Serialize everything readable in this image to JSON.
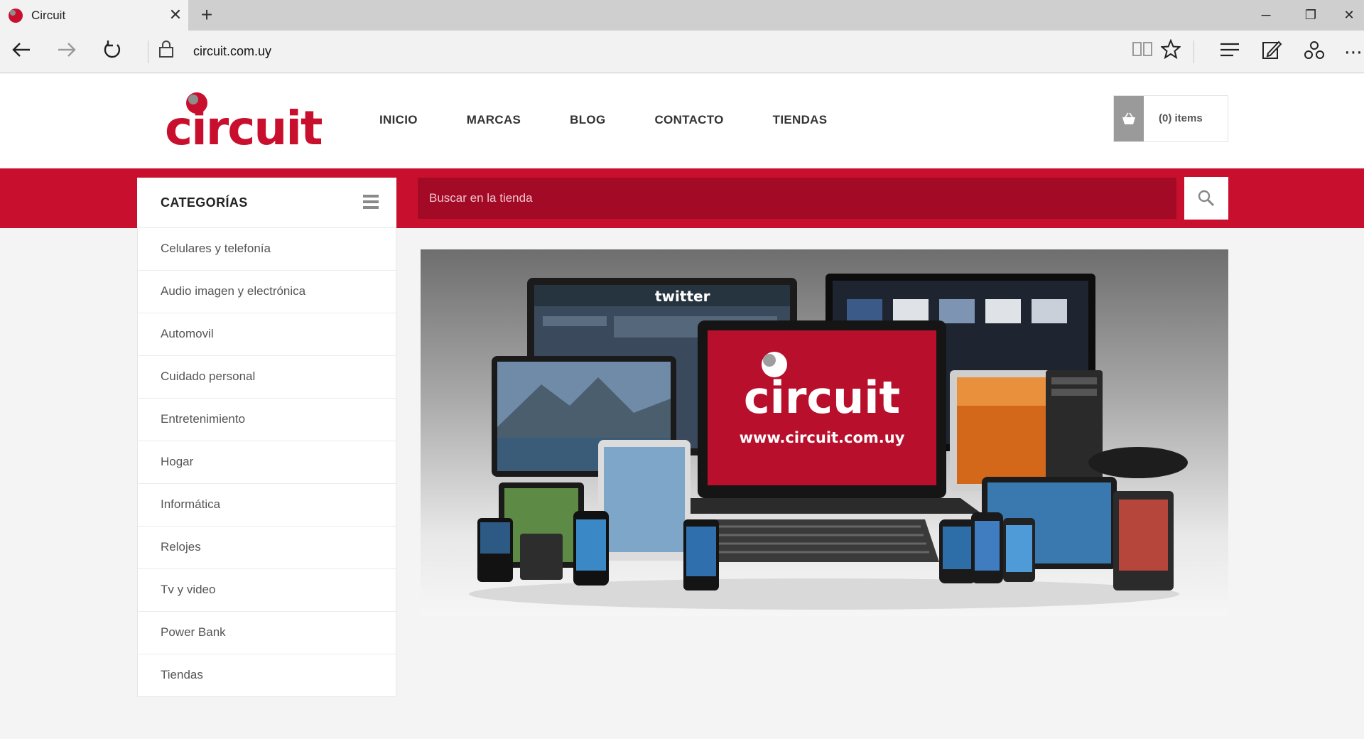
{
  "browser": {
    "tab_title": "Circuit",
    "url": "circuit.com.uy"
  },
  "site": {
    "logo_text": "circuit",
    "nav": [
      {
        "label": "INICIO"
      },
      {
        "label": "MARCAS"
      },
      {
        "label": "BLOG"
      },
      {
        "label": "CONTACTO"
      },
      {
        "label": "TIENDAS"
      }
    ],
    "cart": {
      "label": "(0) items"
    },
    "categories_title": "CATEGORÍAS",
    "search": {
      "placeholder": "Buscar en la tienda"
    },
    "categories": [
      {
        "label": "Celulares y telefonía"
      },
      {
        "label": "Audio imagen y electrónica"
      },
      {
        "label": "Automovil"
      },
      {
        "label": "Cuidado personal"
      },
      {
        "label": "Entretenimiento"
      },
      {
        "label": "Hogar"
      },
      {
        "label": "Informática"
      },
      {
        "label": "Relojes"
      },
      {
        "label": "Tv y video"
      },
      {
        "label": "Power Bank"
      },
      {
        "label": "Tiendas"
      }
    ],
    "banner": {
      "brand": "circuit",
      "url_text": "www.circuit.com.uy",
      "twitter_text": "twitter"
    }
  },
  "colors": {
    "brand_red": "#c8102e",
    "search_bg": "#a30a26"
  },
  "icons": [
    "back-arrow-icon",
    "forward-arrow-icon",
    "refresh-icon",
    "lock-icon",
    "reading-view-icon",
    "favorite-star-icon",
    "hub-icon",
    "web-note-icon",
    "share-icon",
    "more-icon",
    "basket-icon",
    "hamburger-icon",
    "search-icon"
  ]
}
